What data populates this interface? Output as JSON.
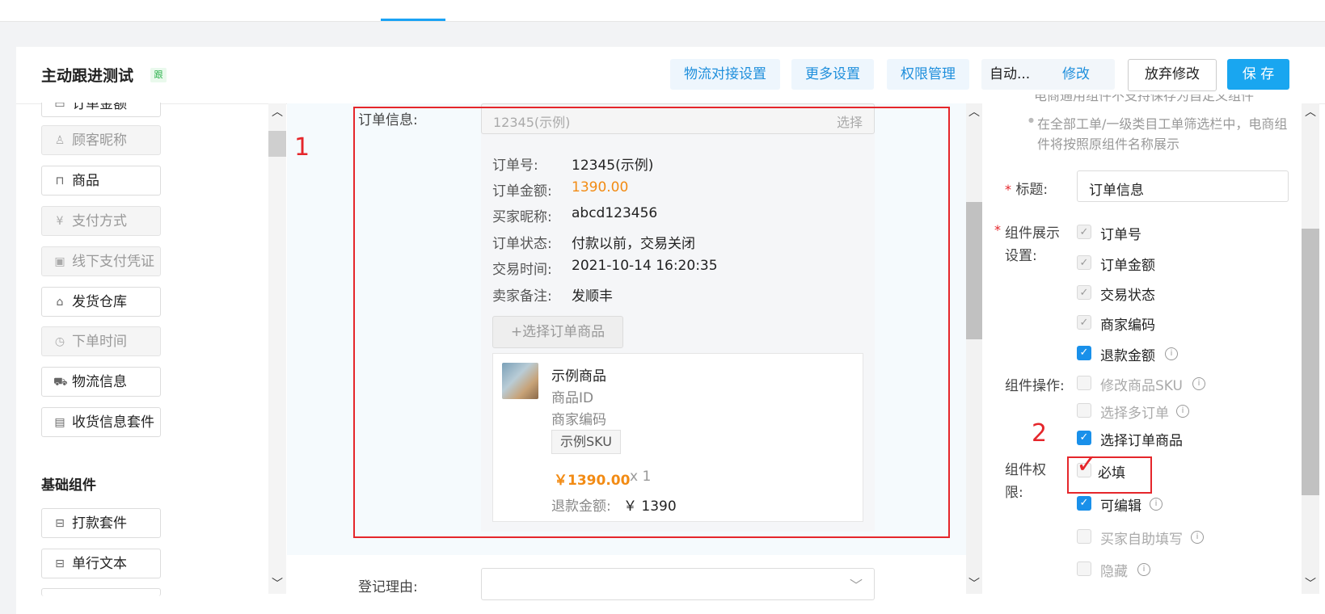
{
  "header": {
    "title": "主动跟进测试",
    "badge": "跟",
    "btn_logistics": "物流对接设置",
    "btn_more": "更多设置",
    "btn_permission": "权限管理",
    "auto_label": "自动...",
    "auto_edit": "修改",
    "btn_discard": "放弃修改",
    "btn_save": "保 存"
  },
  "palette": {
    "items": [
      {
        "label": "订单金额",
        "icon": "file-icon"
      },
      {
        "label": "顾客昵称",
        "icon": "user-icon"
      },
      {
        "label": "商品",
        "icon": "bag-icon"
      },
      {
        "label": "支付方式",
        "icon": "yen-icon"
      },
      {
        "label": "线下支付凭证",
        "icon": "image-icon"
      },
      {
        "label": "发货仓库",
        "icon": "home-icon"
      },
      {
        "label": "下单时间",
        "icon": "clock-icon"
      },
      {
        "label": "物流信息",
        "icon": "truck-icon"
      },
      {
        "label": "收货信息套件",
        "icon": "doc-icon"
      }
    ],
    "section_basic": "基础组件",
    "basic_items": [
      {
        "label": "打款套件",
        "icon": "minus-box-icon"
      },
      {
        "label": "单行文本",
        "icon": "minus-box-icon"
      }
    ]
  },
  "center": {
    "order_label": "订单信息:",
    "order_placeholder": "12345(示例)",
    "order_select": "选择",
    "info": [
      {
        "k": "订单号:",
        "v": "12345(示例)"
      },
      {
        "k": "订单金额:",
        "v": "1390.00"
      },
      {
        "k": "买家昵称:",
        "v": "abcd123456"
      },
      {
        "k": "订单状态:",
        "v": "付款以前，交易关闭"
      },
      {
        "k": "交易时间:",
        "v": "2021-10-14 16:20:35"
      },
      {
        "k": "卖家备注:",
        "v": "发顺丰"
      }
    ],
    "add_goods": "+选择订单商品",
    "product": {
      "name": "示例商品",
      "id": "商品ID",
      "code": "商家编码",
      "sku": "示例SKU",
      "price": "￥1390.00",
      "qty": "x 1",
      "refund_label": "退款金额:",
      "refund_value": "￥ 1390"
    },
    "reason_label": "登记理由:",
    "annotation": "1"
  },
  "right": {
    "hint_top": "电商通用组件不支持保存为自定义组件",
    "hint_bullet": "在全部工单/一级类目工单筛选栏中，电商组件将按照原组件名称展示",
    "title_label": "标题:",
    "title_value": "订单信息",
    "display_label": "组件展示设置:",
    "display_opts": [
      {
        "label": "订单号",
        "state": "dchecked"
      },
      {
        "label": "订单金额",
        "state": "dchecked"
      },
      {
        "label": "交易状态",
        "state": "dchecked"
      },
      {
        "label": "商家编码",
        "state": "dchecked"
      },
      {
        "label": "退款金额",
        "state": "checked"
      }
    ],
    "ops_label": "组件操作:",
    "ops_opts": [
      {
        "label": "修改商品SKU",
        "state": "empty"
      },
      {
        "label": "选择多订单",
        "state": "empty"
      },
      {
        "label": "选择订单商品",
        "state": "checked"
      }
    ],
    "perm_label": "组件权限:",
    "perm_opts": [
      {
        "label": "必填",
        "state": "empty"
      },
      {
        "label": "可编辑",
        "state": "checked"
      },
      {
        "label": "买家自助填写",
        "state": "empty"
      },
      {
        "label": "隐藏",
        "state": "empty"
      }
    ],
    "annotation": "2"
  },
  "colors": {
    "accent": "#19a6f0",
    "annotation_red": "#e5262b",
    "price_orange": "#f28b14"
  }
}
